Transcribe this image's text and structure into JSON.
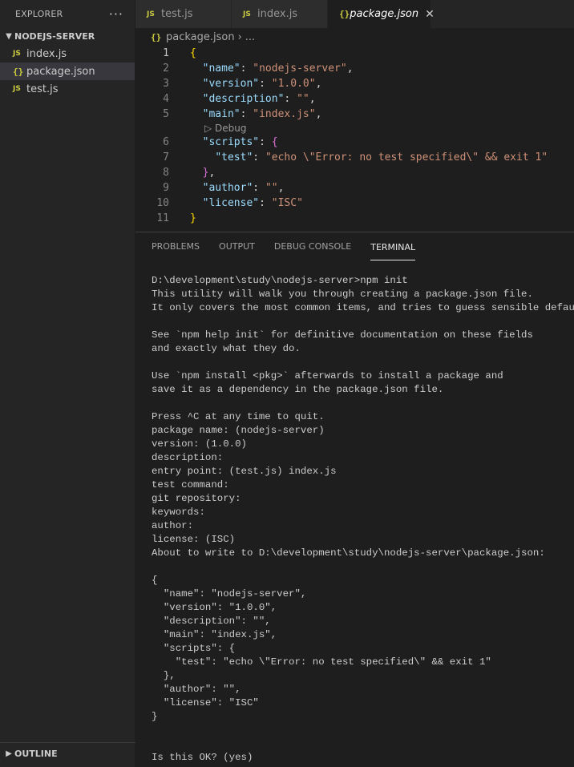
{
  "sidebar": {
    "title": "EXPLORER",
    "more_label": "···",
    "folder_name": "NODEJS-SERVER",
    "files": [
      {
        "name": "index.js",
        "icon": "JS"
      },
      {
        "name": "package.json",
        "icon": "{}"
      },
      {
        "name": "test.js",
        "icon": "JS"
      }
    ],
    "outline_label": "OUTLINE"
  },
  "tabs": [
    {
      "label": "test.js",
      "icon": "JS"
    },
    {
      "label": "index.js",
      "icon": "JS"
    },
    {
      "label": "package.json",
      "icon": "{}",
      "active": true
    }
  ],
  "breadcrumb": {
    "icon": "{}",
    "file": "package.json",
    "rest": "..."
  },
  "editor": {
    "line_numbers": [
      "1",
      "2",
      "3",
      "4",
      "5",
      "6",
      "7",
      "8",
      "9",
      "10",
      "11"
    ],
    "codelens_label": "Debug",
    "json": {
      "open": "{",
      "close": "}",
      "name_key": "\"name\"",
      "name_val": "\"nodejs-server\"",
      "version_key": "\"version\"",
      "version_val": "\"1.0.0\"",
      "description_key": "\"description\"",
      "description_val": "\"\"",
      "main_key": "\"main\"",
      "main_val": "\"index.js\"",
      "scripts_key": "\"scripts\"",
      "scripts_open": "{",
      "test_key": "\"test\"",
      "test_val": "\"echo \\\"Error: no test specified\\\" && exit 1\"",
      "scripts_close": "}",
      "author_key": "\"author\"",
      "author_val": "\"\"",
      "license_key": "\"license\"",
      "license_val": "\"ISC\""
    }
  },
  "panel": {
    "tabs": [
      "PROBLEMS",
      "OUTPUT",
      "DEBUG CONSOLE",
      "TERMINAL"
    ],
    "active_tab": "TERMINAL"
  },
  "terminal": {
    "lines": [
      "D:\\development\\study\\nodejs-server>npm init",
      "This utility will walk you through creating a package.json file.",
      "It only covers the most common items, and tries to guess sensible defaults.",
      "",
      "See `npm help init` for definitive documentation on these fields",
      "and exactly what they do.",
      "",
      "Use `npm install <pkg>` afterwards to install a package and",
      "save it as a dependency in the package.json file.",
      "",
      "Press ^C at any time to quit.",
      "package name: (nodejs-server)",
      "version: (1.0.0)",
      "description:",
      "entry point: (test.js) index.js",
      "test command:",
      "git repository:",
      "keywords:",
      "author:",
      "license: (ISC)",
      "About to write to D:\\development\\study\\nodejs-server\\package.json:",
      "",
      "{",
      "  \"name\": \"nodejs-server\",",
      "  \"version\": \"1.0.0\",",
      "  \"description\": \"\",",
      "  \"main\": \"index.js\",",
      "  \"scripts\": {",
      "    \"test\": \"echo \\\"Error: no test specified\\\" && exit 1\"",
      "  },",
      "  \"author\": \"\",",
      "  \"license\": \"ISC\"",
      "}",
      "",
      "",
      "Is this OK? (yes)"
    ]
  },
  "colors": {
    "accent_yellow": "#cbcb41",
    "json_key": "#9cdcfe",
    "json_string": "#ce9178",
    "brace_gold": "#ffd700",
    "brace_orchid": "#da70d6"
  }
}
